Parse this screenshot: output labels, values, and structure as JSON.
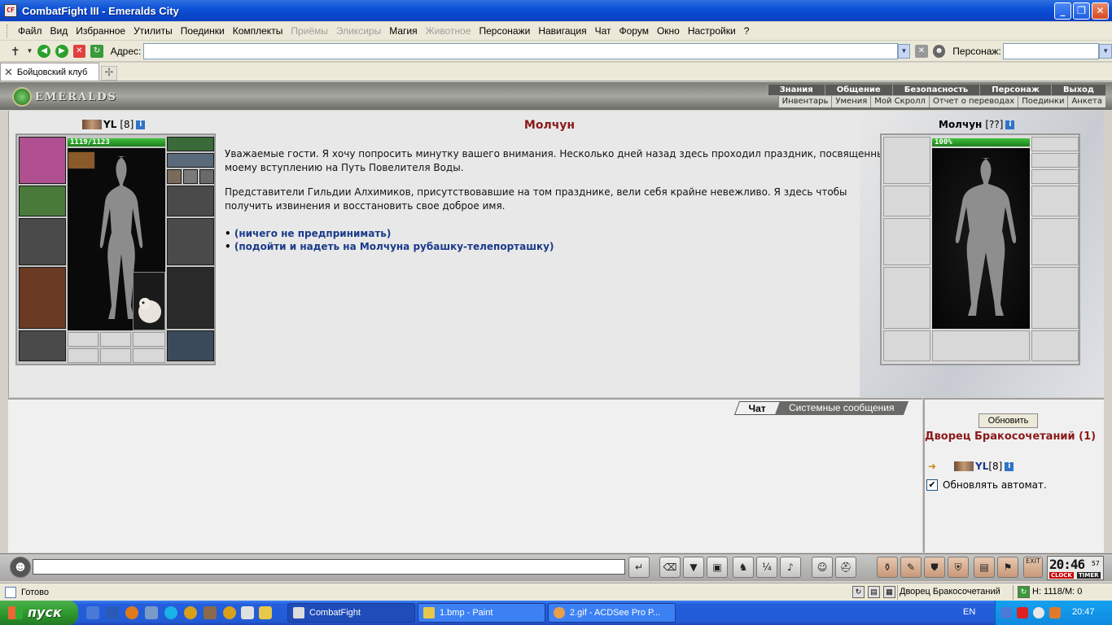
{
  "window": {
    "app_icon": "CF",
    "title": "CombatFight III - Emeralds City"
  },
  "menu": [
    "Файл",
    "Вид",
    "Избранное",
    "Утилиты",
    "Поединки",
    "Комплекты",
    "Приёмы",
    "Эликсиры",
    "Магия",
    "Животное",
    "Персонажи",
    "Навигация",
    "Чат",
    "Форум",
    "Окно",
    "Настройки",
    "?"
  ],
  "menu_disabled": [
    "Приёмы",
    "Эликсиры",
    "Животное"
  ],
  "address": {
    "label": "Адрес:",
    "value": "",
    "persona_label": "Персонаж:",
    "persona_value": ""
  },
  "tabs": [
    {
      "label": "Бойцовский клуб"
    }
  ],
  "game_header": {
    "logo_text": "EMERALDS",
    "nav_primary": [
      "Знания",
      "Общение",
      "Безопасность",
      "Персонаж",
      "Выход"
    ],
    "nav_secondary": [
      "Инвентарь",
      "Умения",
      "Мой Скролл",
      "Отчет о переводах",
      "Поединки",
      "Анкета"
    ]
  },
  "player": {
    "name": "YL",
    "level": "[8]",
    "hp": "1119/1123",
    "hp_fraction": 0.996
  },
  "npc": {
    "name": "Молчун",
    "level": "[??]",
    "hp": "100%",
    "hp_fraction": 1.0
  },
  "dialog": {
    "title": "Молчун",
    "paragraphs": [
      "Уважаемые гости. Я хочу попросить минутку вашего внимания. Несколько дней назад здесь проходил праздник, посвященный моему вступлению на Путь Повелителя Воды.",
      "Представители Гильдии Алхимиков, присутствовавшие на том празднике, вели себя крайне невежливо. Я здесь чтобы получить извинения и восстановить свое доброе имя."
    ],
    "options": [
      "(ничего не предпринимать)",
      "(подойти и надеть на Молчуна рубашку-телепорташку)"
    ]
  },
  "chat": {
    "tab_active": "Чат",
    "tab_inactive": "Системные сообщения",
    "input_value": ""
  },
  "room": {
    "refresh_label": "Обновить",
    "title": "Дворец Бракосочетаний (1)",
    "user_name": "YL",
    "user_level": "[8]",
    "auto_refresh_label": "Обновлять автомат.",
    "auto_refresh_checked": true
  },
  "clock": {
    "time": "20:46",
    "seconds": "57",
    "clock_label": "CLOCK",
    "timer_label": "TIMER"
  },
  "status": {
    "ready": "Готово",
    "room": "Дворец Бракосочетаний",
    "hp_mana": "H: 1118/M: 0"
  },
  "taskbar": {
    "start_label": "пуск",
    "items": [
      "CombatFight",
      "1.bmp - Paint",
      "2.gif - ACDSee Pro P..."
    ],
    "active_index": 0,
    "lang": "EN",
    "time": "20:47"
  },
  "colors": {
    "titlebar": "#0a4fd6",
    "accent_red": "#8a1a1a",
    "link_blue": "#1a3a8a",
    "hp_green": "#1d7e1d"
  }
}
